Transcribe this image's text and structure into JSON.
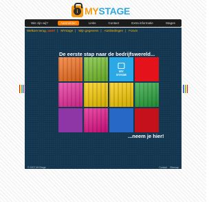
{
  "brand": {
    "logo_glyph": "i",
    "name_part1": "MY",
    "name_part2": "STAGE",
    "accent_orange": "#f49a17",
    "accent_blue": "#2fa8e0"
  },
  "main_nav": {
    "items": [
      {
        "label": "Wie zijn wij?",
        "active": false
      },
      {
        "label": "Aanmelden",
        "active": true
      },
      {
        "label": "Links",
        "active": false
      },
      {
        "label": "Contact",
        "active": false
      },
      {
        "label": "Extra informatie",
        "active": false
      },
      {
        "label": "Stages",
        "active": false
      }
    ]
  },
  "sub_bar": {
    "welcome": "Welkom terug,",
    "name": "user!",
    "links": [
      "MYstage",
      "Mijn gegevens",
      "Aanbiedingen",
      "Forum"
    ]
  },
  "hero": {
    "tagline": "De eerste stap naar de bedrijfswereld...",
    "cta": "...neem je hier!",
    "tile_logo_text_1": "MY",
    "tile_logo_text_2": "STAGE",
    "tiles": [
      {
        "color": "#f36f1e",
        "kind": "photo-orange"
      },
      {
        "color": "#74bf2b",
        "kind": "photo-green"
      },
      {
        "color": "#2aa9e6",
        "kind": "logo"
      },
      {
        "color": "#e3121b",
        "kind": "solid"
      },
      {
        "color": "#e72c9a",
        "kind": "photo-pink"
      },
      {
        "color": "#f6c900",
        "kind": "photo-yellow"
      },
      {
        "color": "#f6c900",
        "kind": "photo-building"
      },
      {
        "color": "#28a33a",
        "kind": "photo-green-building"
      },
      {
        "color": "#8e36a5",
        "kind": "solid"
      },
      {
        "color": "#e3128a",
        "kind": "photo-keyboard"
      },
      {
        "color": "#2767c6",
        "kind": "solid"
      },
      {
        "color": "#c5111b",
        "kind": "solid"
      }
    ]
  },
  "footer": {
    "copyright": "© 2007 MYStage",
    "links": [
      "Contact",
      "Sitemap"
    ]
  }
}
